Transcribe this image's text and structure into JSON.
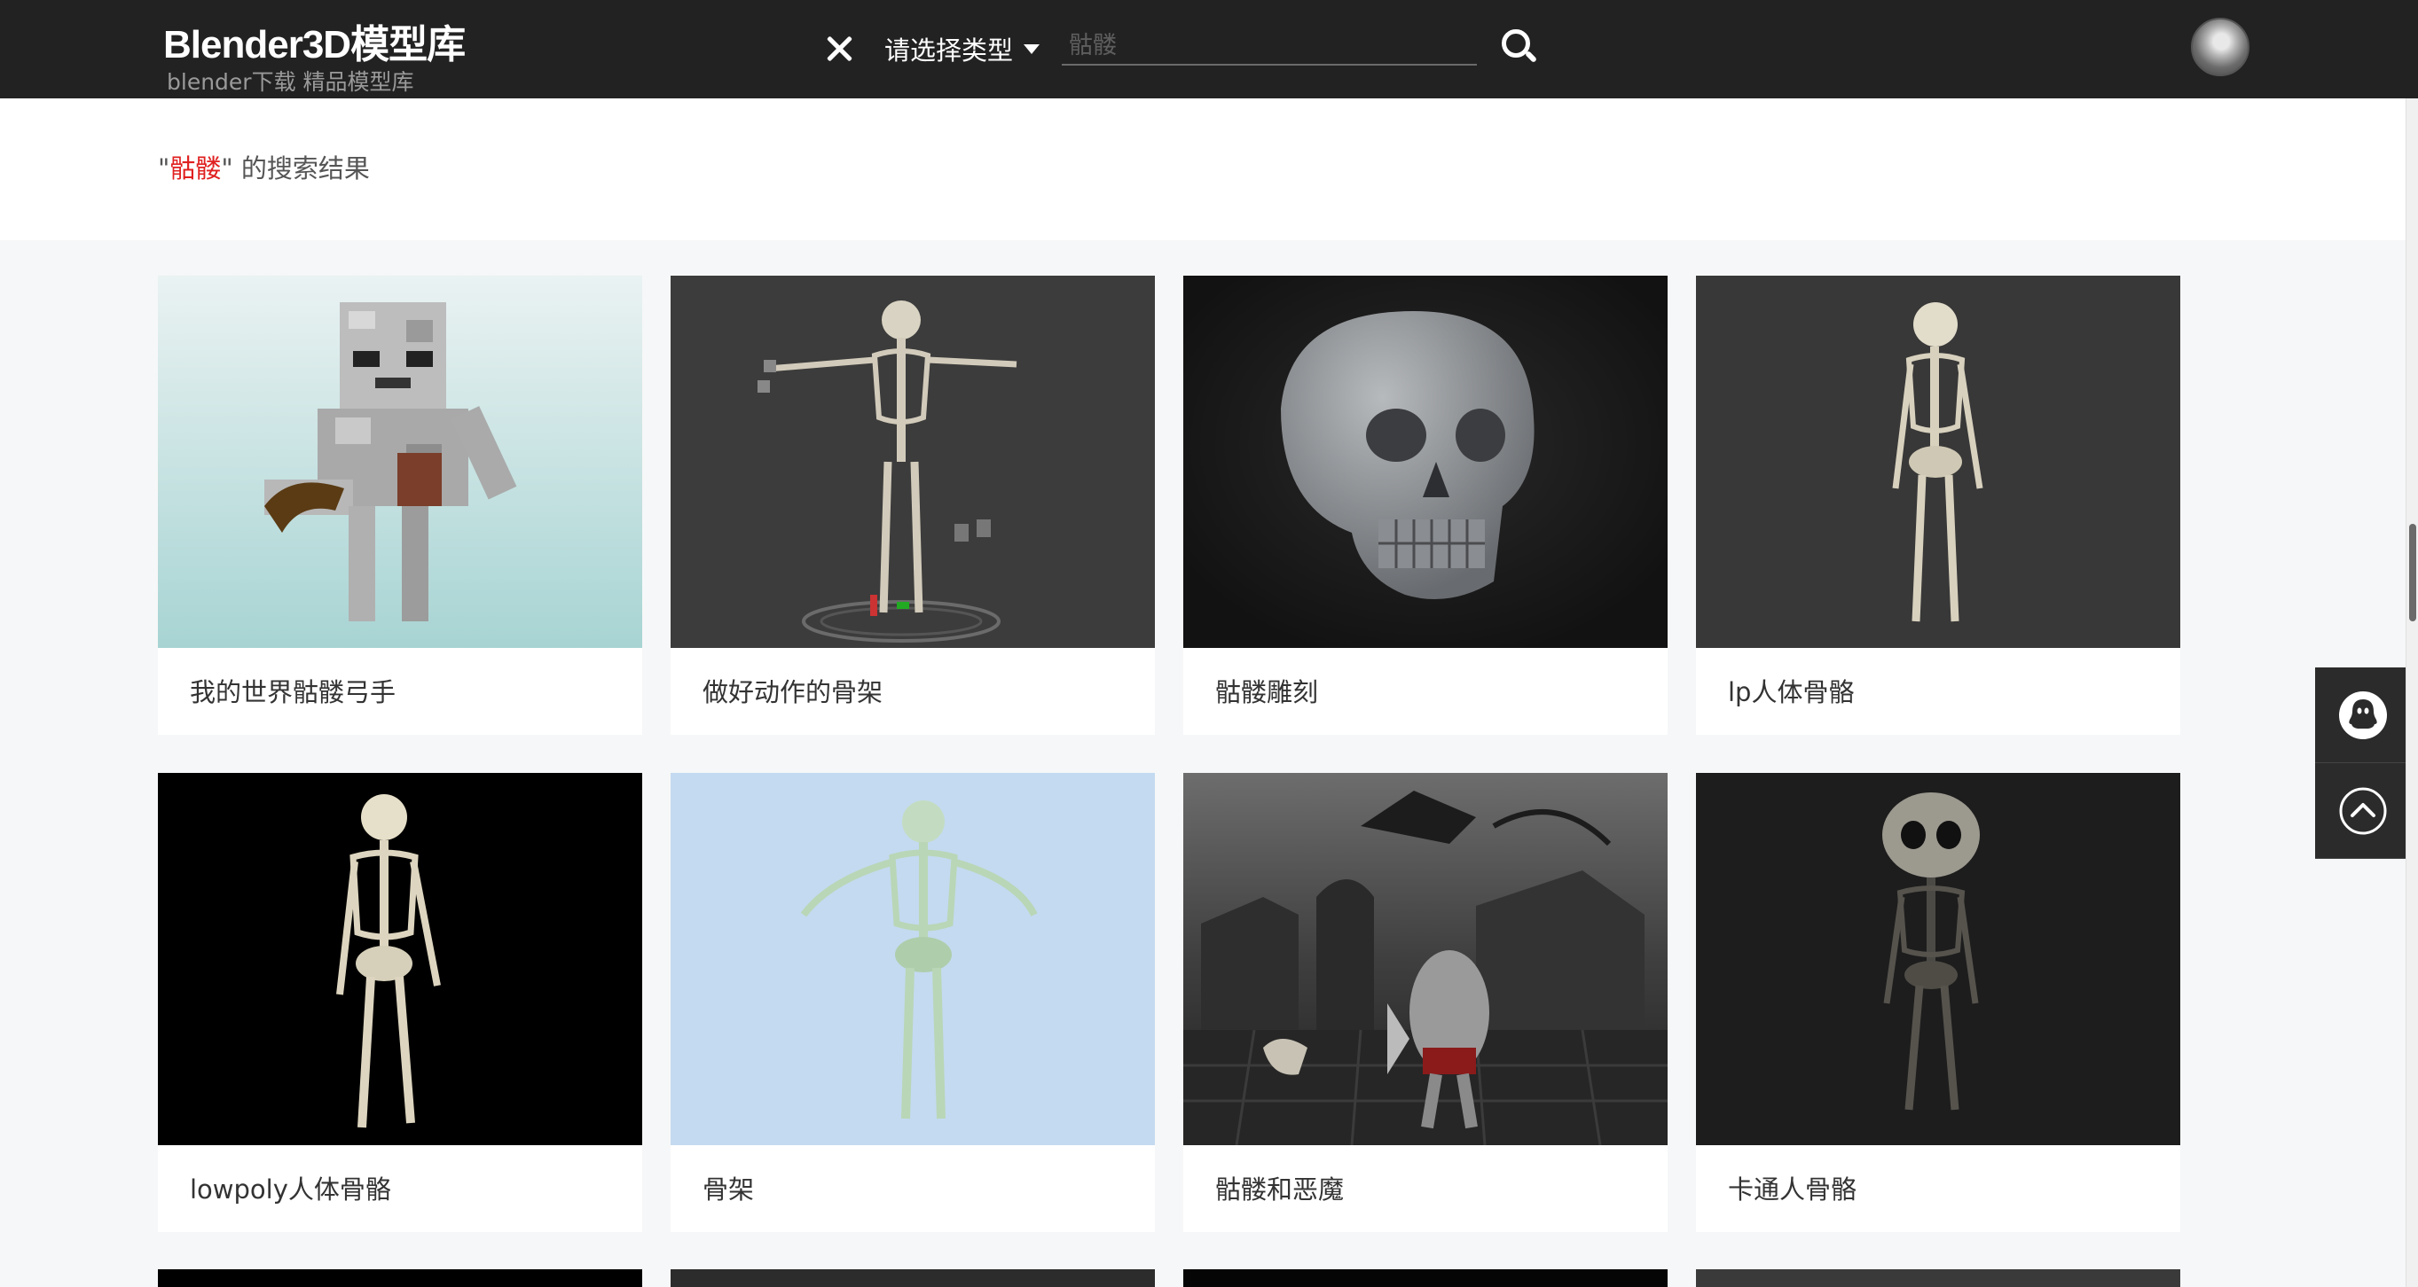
{
  "header": {
    "logo_title": "Blender3D模型库",
    "logo_subtitle": "blender下载 精品模型库",
    "type_select_label": "请选择类型",
    "search_value": "骷髅"
  },
  "search": {
    "quote_open": "\"",
    "keyword": "骷髅",
    "quote_close": "\"",
    "suffix": " 的搜索结果"
  },
  "results": [
    {
      "title": "我的世界骷髅弓手",
      "thumb": "minecraft-skeleton"
    },
    {
      "title": "做好动作的骨架",
      "thumb": "rigged-skeleton"
    },
    {
      "title": "骷髅雕刻",
      "thumb": "skull-sculpt"
    },
    {
      "title": "lp人体骨骼",
      "thumb": "lowpoly-skeleton"
    },
    {
      "title": "lowpoly人体骨骼",
      "thumb": "lowpoly-skeleton-dark"
    },
    {
      "title": "骨架",
      "thumb": "green-skeleton"
    },
    {
      "title": "骷髅和恶魔",
      "thumb": "dungeon-demon"
    },
    {
      "title": "卡通人骨骼",
      "thumb": "cartoon-skeleton"
    }
  ],
  "colors": {
    "header_bg": "#222222",
    "keyword": "#e02020",
    "page_bg": "#f6f7f8",
    "side_tool_bg": "#2b2b2b"
  },
  "icons": {
    "clear": "close-icon",
    "dropdown": "caret-down-icon",
    "search": "search-icon",
    "support": "qq-penguin-icon",
    "back_to_top": "arrow-up-circle-icon"
  }
}
